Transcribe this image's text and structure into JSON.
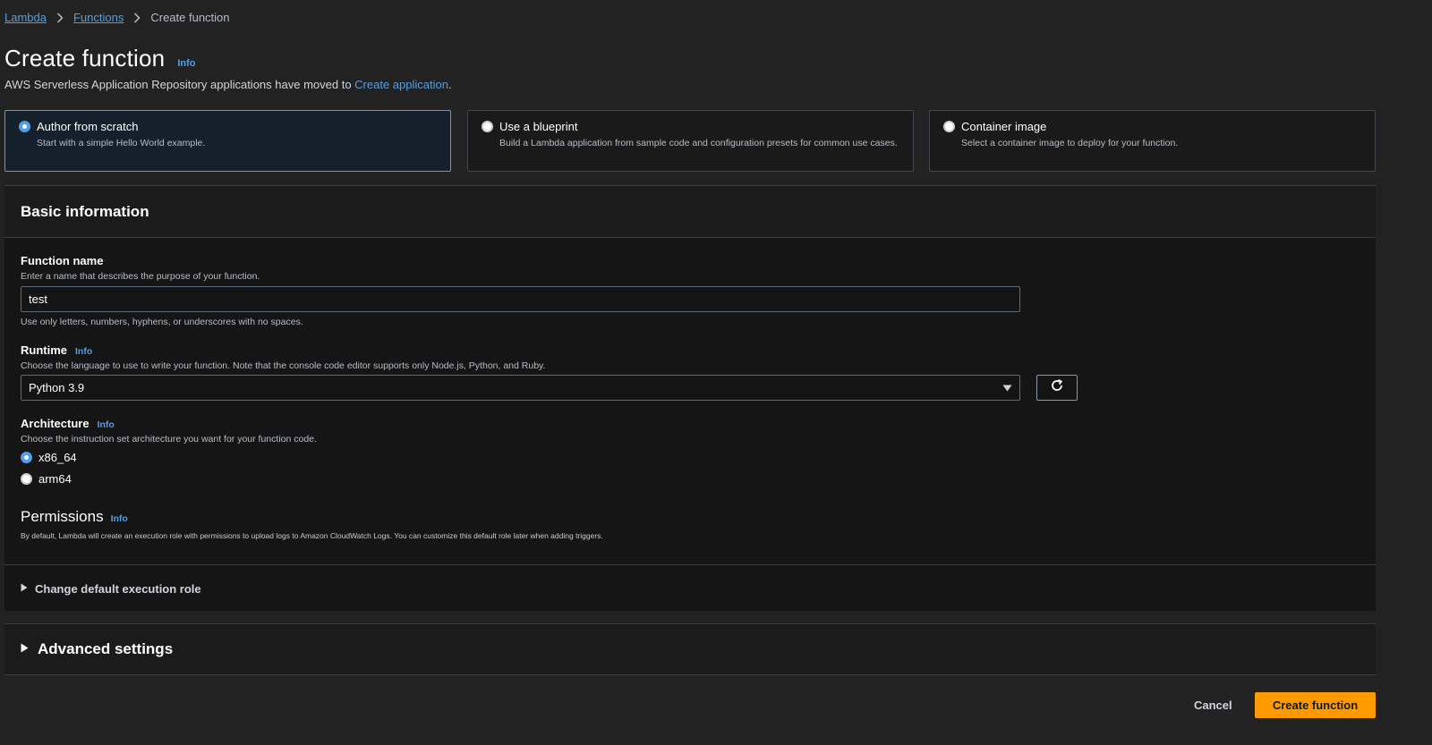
{
  "breadcrumb": {
    "items": [
      {
        "label": "Lambda"
      },
      {
        "label": "Functions"
      },
      {
        "label": "Create function"
      }
    ]
  },
  "header": {
    "title": "Create function",
    "info": "Info",
    "note_prefix": "AWS Serverless Application Repository applications have moved to ",
    "note_link": "Create application",
    "note_suffix": "."
  },
  "options": [
    {
      "title": "Author from scratch",
      "desc": "Start with a simple Hello World example.",
      "selected": true
    },
    {
      "title": "Use a blueprint",
      "desc": "Build a Lambda application from sample code and configuration presets for common use cases.",
      "selected": false
    },
    {
      "title": "Container image",
      "desc": "Select a container image to deploy for your function.",
      "selected": false
    }
  ],
  "basic": {
    "heading": "Basic information",
    "function_name": {
      "label": "Function name",
      "desc": "Enter a name that describes the purpose of your function.",
      "value": "test",
      "hint": "Use only letters, numbers, hyphens, or underscores with no spaces."
    },
    "runtime": {
      "label": "Runtime",
      "info": "Info",
      "desc": "Choose the language to use to write your function. Note that the console code editor supports only Node.js, Python, and Ruby.",
      "value": "Python 3.9"
    },
    "architecture": {
      "label": "Architecture",
      "info": "Info",
      "desc": "Choose the instruction set architecture you want for your function code.",
      "options": [
        {
          "label": "x86_64",
          "selected": true
        },
        {
          "label": "arm64",
          "selected": false
        }
      ]
    },
    "permissions": {
      "label": "Permissions",
      "info": "Info",
      "desc": "By default, Lambda will create an execution role with permissions to upload logs to Amazon CloudWatch Logs. You can customize this default role later when adding triggers."
    },
    "change_role": "Change default execution role"
  },
  "advanced": {
    "label": "Advanced settings"
  },
  "footer": {
    "cancel": "Cancel",
    "create": "Create function"
  },
  "colors": {
    "background": "#222222",
    "link": "#539fe5",
    "primary_button": "#ff9900"
  }
}
